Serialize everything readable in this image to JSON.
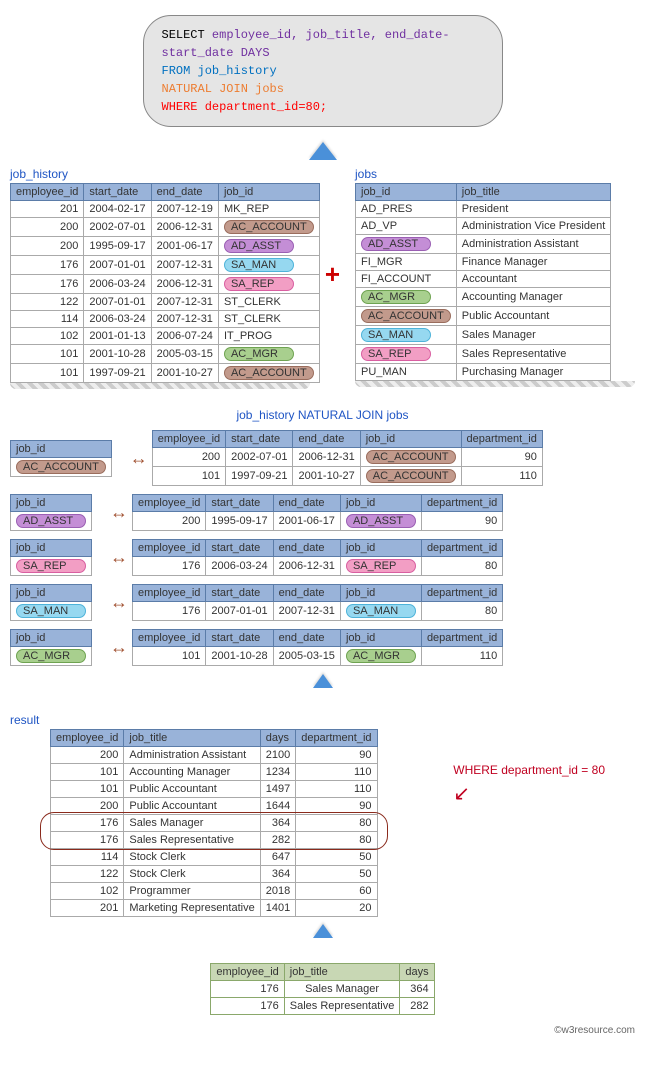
{
  "sql": {
    "select_kw": "SELECT ",
    "select_cols": "employee_id, job_title, end_date-start_date DAYS",
    "from": "FROM job_history",
    "join": "NATURAL JOIN jobs",
    "where": "WHERE department_id=80;"
  },
  "labels": {
    "job_history": "job_history",
    "jobs": "jobs",
    "join_title": "job_history NATURAL JOIN jobs",
    "result": "result",
    "where_note": "WHERE department_id = 80",
    "footer": "©w3resource.com"
  },
  "pill_colors": {
    "AC_ACCOUNT": "c-acacct",
    "AD_ASST": "c-adasst",
    "SA_MAN": "c-saman",
    "SA_REP": "c-sarep",
    "AC_MGR": "c-acmgr"
  },
  "job_history": {
    "cols": [
      "employee_id",
      "start_date",
      "end_date",
      "job_id"
    ],
    "rows": [
      {
        "employee_id": 201,
        "start_date": "2004-02-17",
        "end_date": "2007-12-19",
        "job_id": "MK_REP"
      },
      {
        "employee_id": 200,
        "start_date": "2002-07-01",
        "end_date": "2006-12-31",
        "job_id": "AC_ACCOUNT"
      },
      {
        "employee_id": 200,
        "start_date": "1995-09-17",
        "end_date": "2001-06-17",
        "job_id": "AD_ASST"
      },
      {
        "employee_id": 176,
        "start_date": "2007-01-01",
        "end_date": "2007-12-31",
        "job_id": "SA_MAN"
      },
      {
        "employee_id": 176,
        "start_date": "2006-03-24",
        "end_date": "2006-12-31",
        "job_id": "SA_REP"
      },
      {
        "employee_id": 122,
        "start_date": "2007-01-01",
        "end_date": "2007-12-31",
        "job_id": "ST_CLERK"
      },
      {
        "employee_id": 114,
        "start_date": "2006-03-24",
        "end_date": "2007-12-31",
        "job_id": "ST_CLERK"
      },
      {
        "employee_id": 102,
        "start_date": "2001-01-13",
        "end_date": "2006-07-24",
        "job_id": "IT_PROG"
      },
      {
        "employee_id": 101,
        "start_date": "2001-10-28",
        "end_date": "2005-03-15",
        "job_id": "AC_MGR"
      },
      {
        "employee_id": 101,
        "start_date": "1997-09-21",
        "end_date": "2001-10-27",
        "job_id": "AC_ACCOUNT"
      }
    ]
  },
  "jobs": {
    "cols": [
      "job_id",
      "job_title"
    ],
    "rows": [
      {
        "job_id": "AD_PRES",
        "job_title": "President"
      },
      {
        "job_id": "AD_VP",
        "job_title": "Administration Vice President"
      },
      {
        "job_id": "AD_ASST",
        "job_title": "Administration Assistant"
      },
      {
        "job_id": "FI_MGR",
        "job_title": "Finance Manager"
      },
      {
        "job_id": "FI_ACCOUNT",
        "job_title": "Accountant"
      },
      {
        "job_id": "AC_MGR",
        "job_title": "Accounting Manager"
      },
      {
        "job_id": "AC_ACCOUNT",
        "job_title": "Public Accountant"
      },
      {
        "job_id": "SA_MAN",
        "job_title": "Sales Manager"
      },
      {
        "job_id": "SA_REP",
        "job_title": "Sales Representative"
      },
      {
        "job_id": "PU_MAN",
        "job_title": "Purchasing Manager"
      }
    ]
  },
  "natural_join": {
    "detail_cols": [
      "employee_id",
      "start_date",
      "end_date",
      "job_id",
      "department_id"
    ],
    "groups": [
      {
        "key": "AC_ACCOUNT",
        "rows": [
          {
            "employee_id": 200,
            "start_date": "2002-07-01",
            "end_date": "2006-12-31",
            "job_id": "AC_ACCOUNT",
            "department_id": 90
          },
          {
            "employee_id": 101,
            "start_date": "1997-09-21",
            "end_date": "2001-10-27",
            "job_id": "AC_ACCOUNT",
            "department_id": 110
          }
        ]
      },
      {
        "key": "AD_ASST",
        "rows": [
          {
            "employee_id": 200,
            "start_date": "1995-09-17",
            "end_date": "2001-06-17",
            "job_id": "AD_ASST",
            "department_id": 90
          }
        ]
      },
      {
        "key": "SA_REP",
        "rows": [
          {
            "employee_id": 176,
            "start_date": "2006-03-24",
            "end_date": "2006-12-31",
            "job_id": "SA_REP",
            "department_id": 80
          }
        ]
      },
      {
        "key": "SA_MAN",
        "rows": [
          {
            "employee_id": 176,
            "start_date": "2007-01-01",
            "end_date": "2007-12-31",
            "job_id": "SA_MAN",
            "department_id": 80
          }
        ]
      },
      {
        "key": "AC_MGR",
        "rows": [
          {
            "employee_id": 101,
            "start_date": "2001-10-28",
            "end_date": "2005-03-15",
            "job_id": "AC_MGR",
            "department_id": 110
          }
        ]
      }
    ]
  },
  "result": {
    "cols": [
      "employee_id",
      "job_title",
      "days",
      "department_id"
    ],
    "rows": [
      {
        "employee_id": 200,
        "job_title": "Administration Assistant",
        "days": 2100,
        "department_id": 90
      },
      {
        "employee_id": 101,
        "job_title": "Accounting Manager",
        "days": 1234,
        "department_id": 110
      },
      {
        "employee_id": 101,
        "job_title": "Public Accountant",
        "days": 1497,
        "department_id": 110
      },
      {
        "employee_id": 200,
        "job_title": "Public Accountant",
        "days": 1644,
        "department_id": 90
      },
      {
        "employee_id": 176,
        "job_title": "Sales Manager",
        "days": 364,
        "department_id": 80,
        "hl": true
      },
      {
        "employee_id": 176,
        "job_title": "Sales Representative",
        "days": 282,
        "department_id": 80,
        "hl": true
      },
      {
        "employee_id": 114,
        "job_title": "Stock Clerk",
        "days": 647,
        "department_id": 50
      },
      {
        "employee_id": 122,
        "job_title": "Stock Clerk",
        "days": 364,
        "department_id": 50
      },
      {
        "employee_id": 102,
        "job_title": "Programmer",
        "days": 2018,
        "department_id": 60
      },
      {
        "employee_id": 201,
        "job_title": "Marketing Representative",
        "days": 1401,
        "department_id": 20
      }
    ]
  },
  "final": {
    "cols": [
      "employee_id",
      "job_title",
      "days"
    ],
    "rows": [
      {
        "employee_id": 176,
        "job_title": "Sales Manager",
        "days": 364
      },
      {
        "employee_id": 176,
        "job_title": "Sales Representative",
        "days": 282
      }
    ]
  }
}
